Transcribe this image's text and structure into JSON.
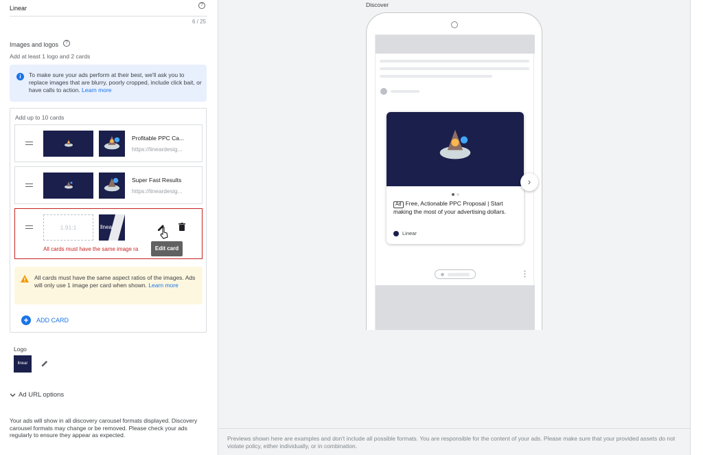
{
  "headline": {
    "value": "Linear",
    "counter": "6 / 25"
  },
  "images_section": {
    "title": "Images and logos",
    "subtitle": "Add at least 1 logo and 2 cards",
    "info_text": "To make sure your ads perform at their best, we'll ask you to replace images that are blurry, poorly cropped, include click bait, or have calls to action.",
    "info_link": "Learn more"
  },
  "cards": {
    "header": "Add up to 10 cards",
    "items": [
      {
        "title": "Profitable PPC Ca...",
        "url": "https://lineardesig..."
      },
      {
        "title": "Super Fast Results",
        "url": "https://lineardesig..."
      }
    ],
    "editing": {
      "placeholder": "1.91:1",
      "square_text": "llnear",
      "error": "All cards must have the same image ra",
      "tooltip": "Edit card"
    },
    "warning_text": "All cards must have the same aspect ratios of the images. Ads will only use 1 image per card when shown.",
    "warning_link": "Learn more",
    "add_label": "ADD CARD"
  },
  "logo": {
    "label": "Logo",
    "thumb_text": "llnear"
  },
  "url_options": {
    "label": "Ad URL options"
  },
  "bottom_note": "Your ads will show in all discovery carousel formats displayed. Discovery carousel formats may change or be removed. Please check your ads regularly to ensure they appear as expected.",
  "preview": {
    "label": "Discover",
    "ad_badge": "Ad",
    "ad_text": "Free, Actionable PPC Proposal | Start making the most of your advertising dollars.",
    "brand": "Linear"
  },
  "footer": "Previews shown here are examples and don't include all possible formats. You are responsible for the content of your ads. Please make sure that your provided assets do not violate policy, either individually, or in combination.",
  "colors": {
    "accent": "#1a73e8",
    "error": "#c5221f",
    "warning_bg": "#fef7e0",
    "card_bg": "#1b1f4b"
  }
}
